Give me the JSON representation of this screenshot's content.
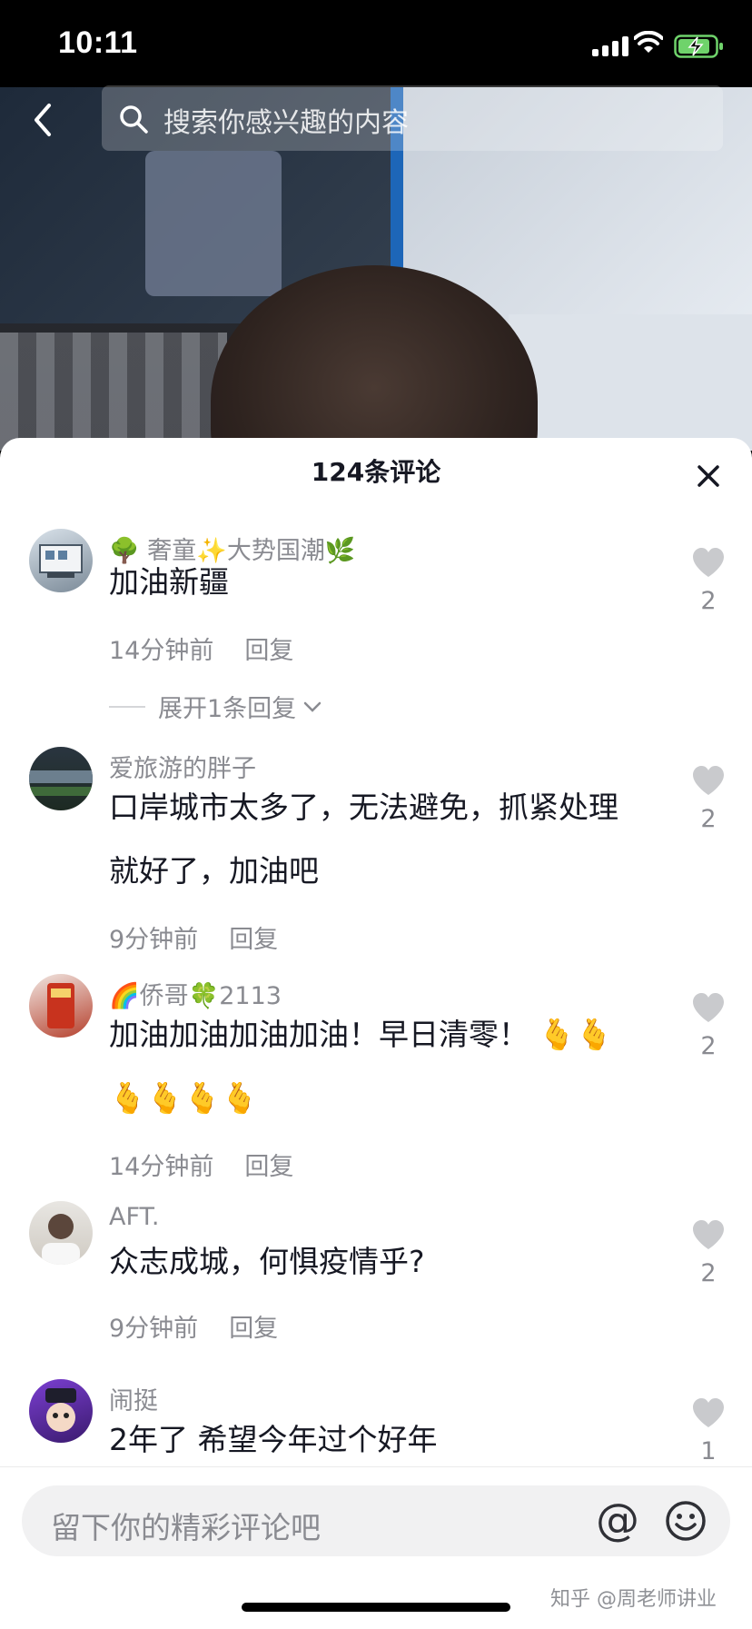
{
  "status_bar": {
    "time": "10:11"
  },
  "top_bar": {
    "search_placeholder": "搜索你感兴趣的内容"
  },
  "sheet": {
    "title": "124条评论"
  },
  "comments": [
    {
      "username": "🌳 奢童✨大势国潮🌿",
      "text": "加油新疆",
      "time": "14分钟前",
      "reply": "回复",
      "likes": "2",
      "expand": "展开1条回复"
    },
    {
      "username": "爱旅游的胖子",
      "text": "口岸城市太多了，无法避免，抓紧处理就好了，加油吧",
      "time": "9分钟前",
      "reply": "回复",
      "likes": "2"
    },
    {
      "username": "🌈侨哥🍀2113",
      "text": "加油加油加油加油！早日清零！ 🫰🫰🫰🫰🫰🫰",
      "time": "14分钟前",
      "reply": "回复",
      "likes": "2"
    },
    {
      "username": "AFT.",
      "text": "众志成城，何惧疫情乎?",
      "time": "9分钟前",
      "reply": "回复",
      "likes": "2"
    },
    {
      "username": "闹挺",
      "text": "2年了 希望今年过个好年",
      "likes": "1"
    }
  ],
  "input_bar": {
    "placeholder": "留下你的精彩评论吧",
    "at": "@"
  },
  "watermark": "知乎 @周老师讲业",
  "colors": {
    "secondary_text": "#8a8b91",
    "primary_text": "#161823",
    "like_icon": "#c9cacd"
  }
}
